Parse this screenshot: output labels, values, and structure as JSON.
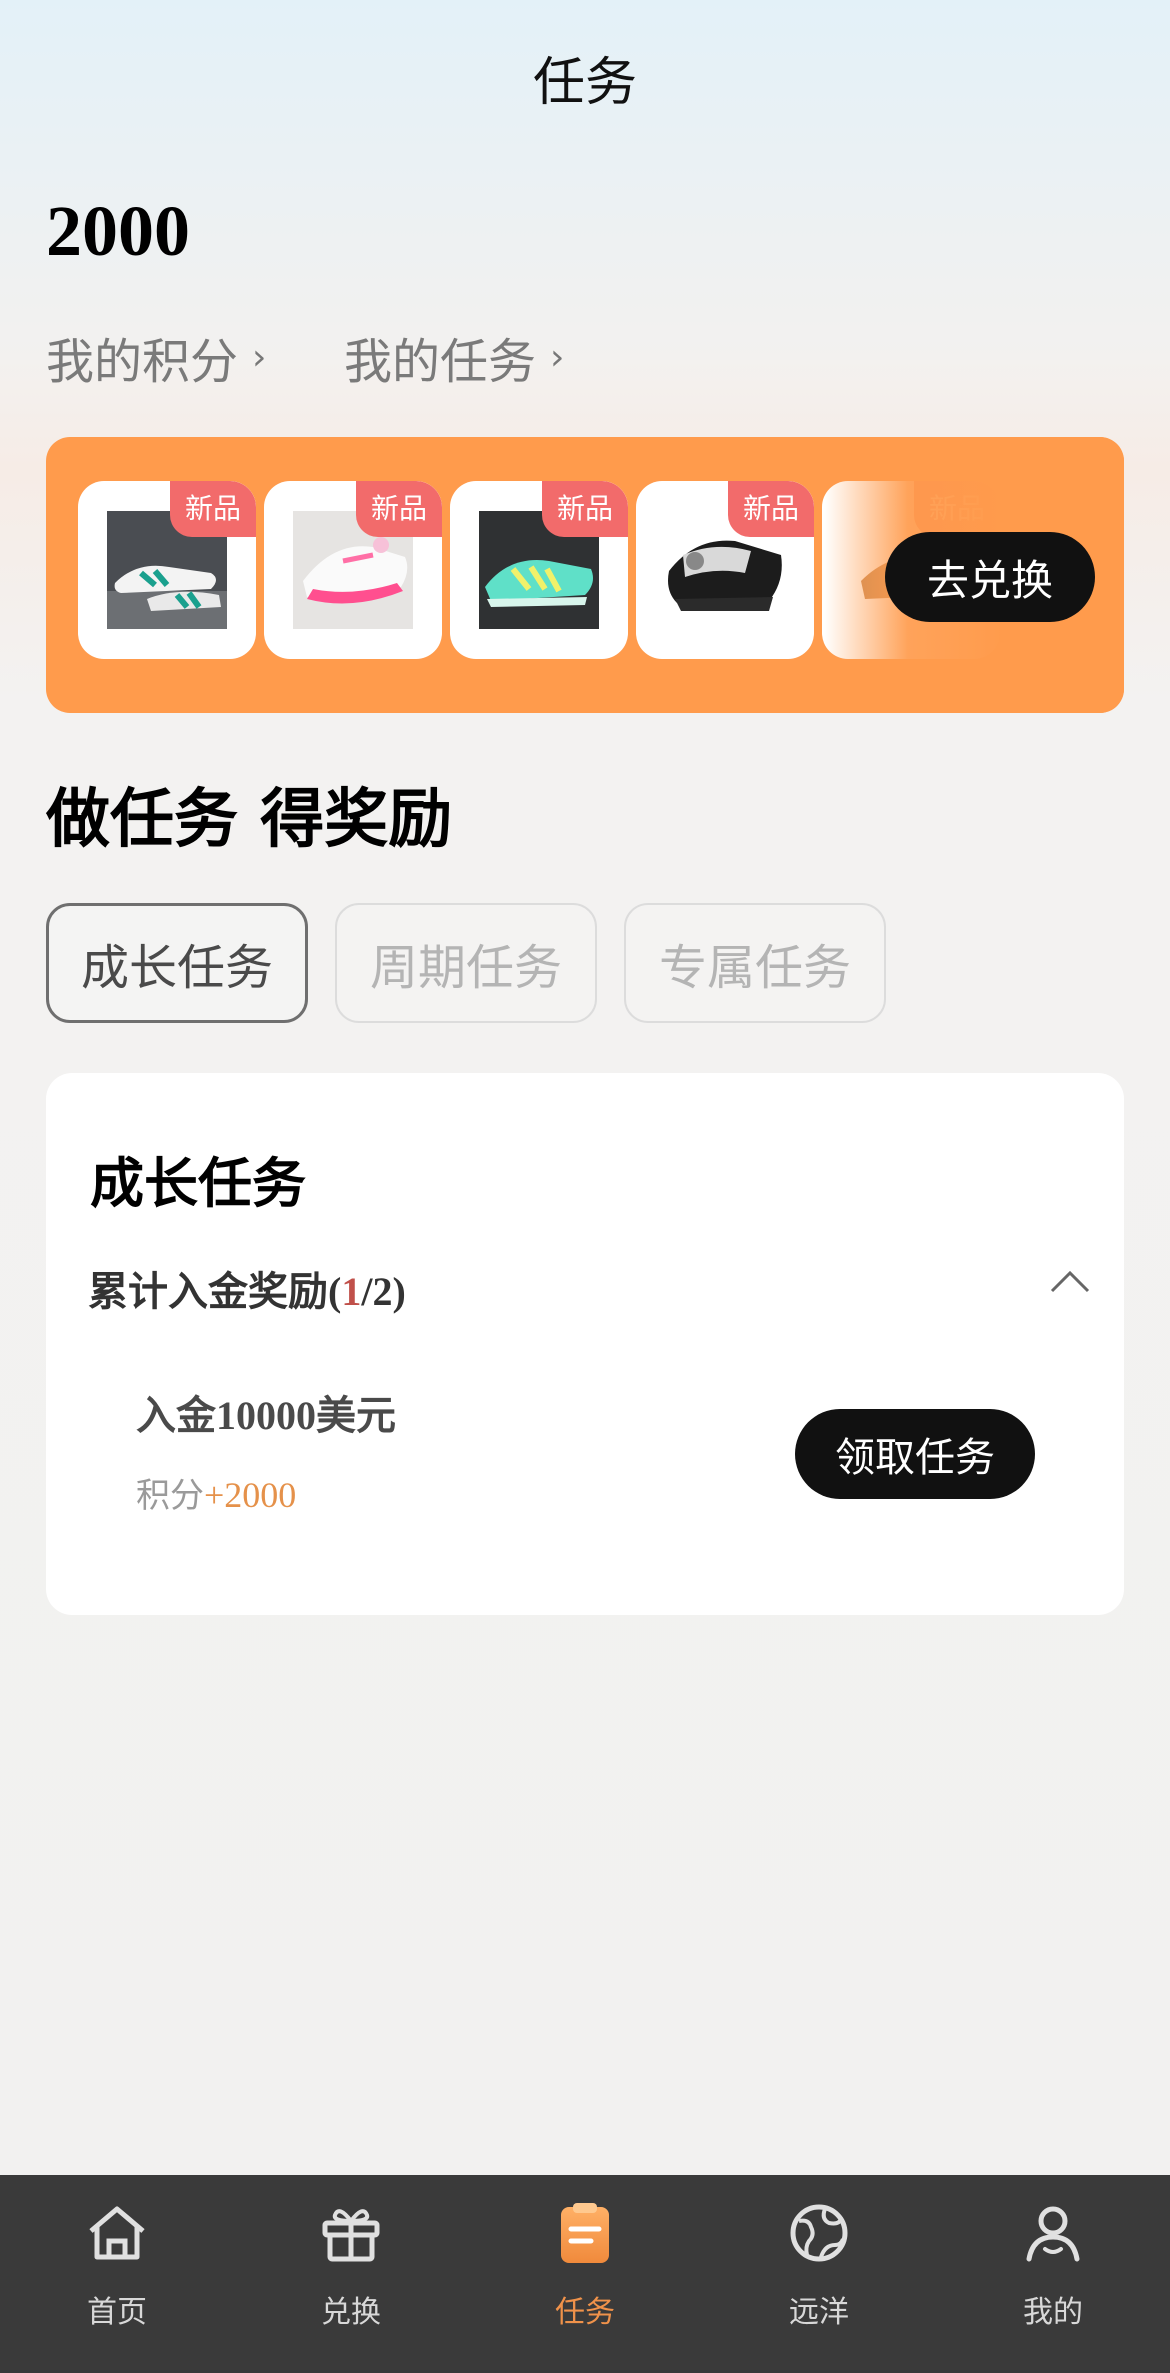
{
  "header": {
    "title": "任务"
  },
  "points": {
    "value": "2000",
    "my_points_link": "我的积分",
    "my_tasks_link": "我的任务"
  },
  "banner": {
    "badge": "新品",
    "exchange_button": "去兑换",
    "products": [
      {
        "name": "white-teal-shoe"
      },
      {
        "name": "white-pink-shoe"
      },
      {
        "name": "teal-yellow-shoe"
      },
      {
        "name": "black-white-shoe"
      },
      {
        "name": "faded-shoe"
      }
    ]
  },
  "section": {
    "title": "做任务 得奖励"
  },
  "tabs": [
    {
      "label": "成长任务",
      "active": true
    },
    {
      "label": "周期任务",
      "active": false
    },
    {
      "label": "专属任务",
      "active": false
    }
  ],
  "card": {
    "title": "成长任务",
    "group": {
      "label": "累计入金奖励",
      "progress_done": "1",
      "progress_total": "2"
    },
    "task": {
      "name_prefix": "入金",
      "name_amount": "10000",
      "name_suffix": "美元",
      "reward_label": "积分",
      "reward_value": "+2000",
      "button": "领取任务"
    }
  },
  "colors": {
    "accent": "#ff9b4c",
    "active_tab": "#f0924a",
    "badge": "#f26b6b",
    "dark_button": "#111111"
  },
  "tabbar": [
    {
      "label": "首页",
      "icon": "home-icon"
    },
    {
      "label": "兑换",
      "icon": "gift-icon"
    },
    {
      "label": "任务",
      "icon": "clipboard-icon",
      "active": true
    },
    {
      "label": "远洋",
      "icon": "globe-icon"
    },
    {
      "label": "我的",
      "icon": "user-icon"
    }
  ]
}
